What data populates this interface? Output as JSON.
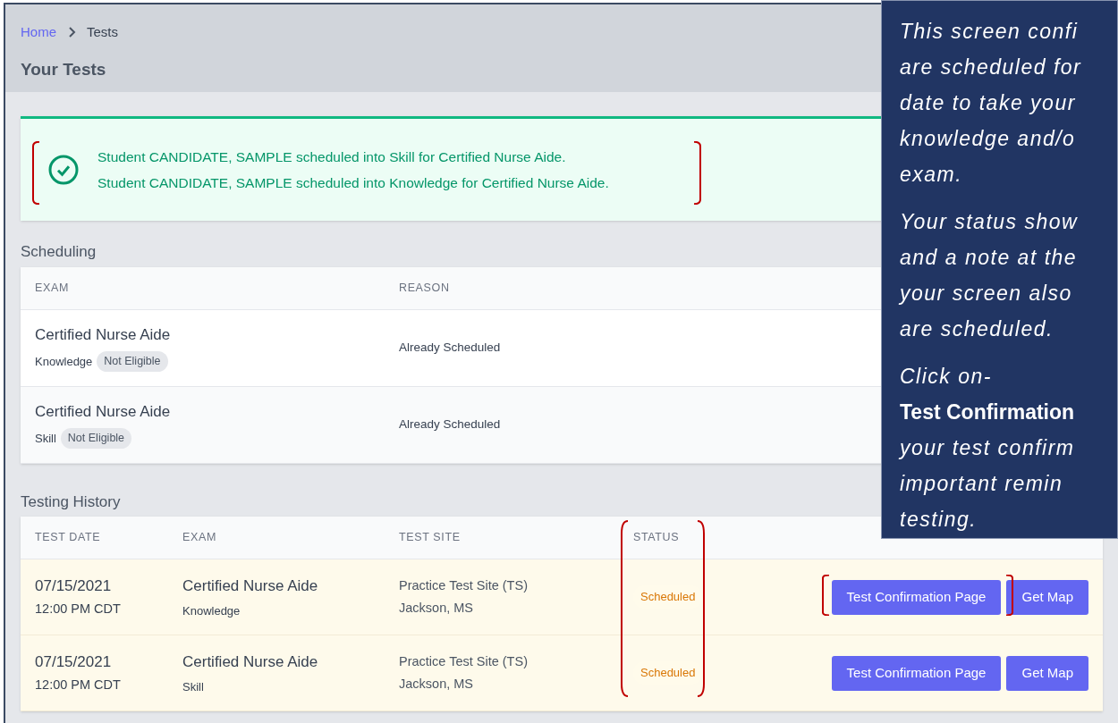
{
  "breadcrumb": [
    {
      "label": "Home",
      "kind": "link"
    },
    {
      "label": "Tests",
      "kind": "current"
    }
  ],
  "page_title": "Your Tests",
  "alert": {
    "messages": [
      "Student CANDIDATE, SAMPLE scheduled into Skill for Certified Nurse Aide.",
      "Student CANDIDATE, SAMPLE scheduled into Knowledge for Certified Nurse Aide."
    ]
  },
  "scheduling": {
    "title": "Scheduling",
    "columns": [
      "EXAM",
      "REASON"
    ],
    "rows": [
      {
        "exam": "Certified Nurse Aide",
        "type": "Knowledge",
        "badge": "Not Eligible",
        "reason": "Already Scheduled"
      },
      {
        "exam": "Certified Nurse Aide",
        "type": "Skill",
        "badge": "Not Eligible",
        "reason": "Already Scheduled"
      }
    ]
  },
  "testing_history": {
    "title": "Testing History",
    "columns": [
      "TEST DATE",
      "EXAM",
      "TEST SITE",
      "STATUS"
    ],
    "rows": [
      {
        "date": "07/15/2021",
        "time": "12:00 PM CDT",
        "exam": "Certified Nurse Aide",
        "type": "Knowledge",
        "site": "Practice Test Site (TS)",
        "city": "Jackson, MS",
        "status": "Scheduled",
        "buttons": [
          "Test Confirmation Page",
          "Get Map"
        ]
      },
      {
        "date": "07/15/2021",
        "time": "12:00 PM CDT",
        "exam": "Certified Nurse Aide",
        "type": "Skill",
        "site": "Practice Test Site (TS)",
        "city": "Jackson, MS",
        "status": "Scheduled",
        "buttons": [
          "Test Confirmation Page",
          "Get Map"
        ]
      }
    ]
  },
  "callout": {
    "paragraphs": [
      [
        {
          "text": "This screen confi",
          "kind": "italic"
        },
        {
          "text": "are scheduled for",
          "kind": "italic"
        },
        {
          "text": "date to take your",
          "kind": "italic"
        },
        {
          "text": "knowledge and/o",
          "kind": "italic"
        },
        {
          "text": "exam.",
          "kind": "italic"
        }
      ],
      [
        {
          "text": "Your status show",
          "kind": "italic"
        },
        {
          "text": "and a note at the",
          "kind": "italic"
        },
        {
          "text": "your screen also",
          "kind": "italic"
        },
        {
          "text": "are scheduled.",
          "kind": "italic"
        }
      ],
      [
        {
          "text": "Click on-",
          "kind": "italic"
        },
        {
          "text": "Test Confirmation",
          "kind": "bold"
        },
        {
          "text": "your test confirm",
          "kind": "italic"
        },
        {
          "text": "important remin",
          "kind": "italic"
        },
        {
          "text": "testing.",
          "kind": "italic"
        }
      ]
    ]
  }
}
